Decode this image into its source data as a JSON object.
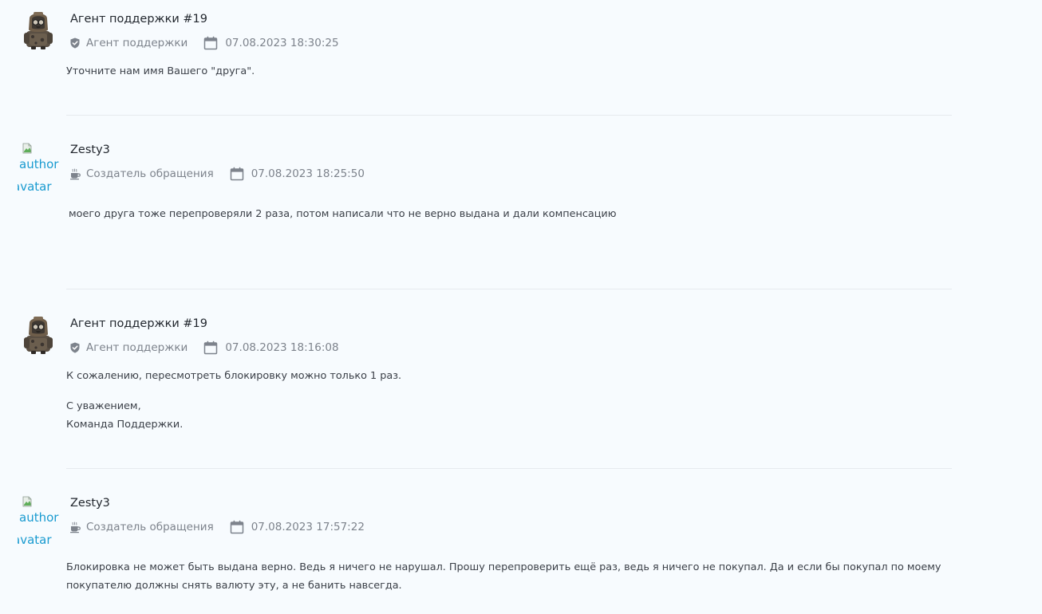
{
  "messages": [
    {
      "author": "Агент поддержки #19",
      "role": "Агент поддержки",
      "datetime": "07.08.2023 18:30:25",
      "lines": [
        "Уточните нам имя Вашего \"друга\"."
      ]
    },
    {
      "author": "Zesty3",
      "role": "Создатель обращения",
      "datetime": "07.08.2023 18:25:50",
      "avatar_alt": [
        "author",
        "avatar"
      ],
      "lines": [
        "моего друга тоже перепроверяли 2 раза, потом написали что не верно выдана и дали компенсацию"
      ]
    },
    {
      "author": "Агент поддержки #19",
      "role": "Агент поддержки",
      "datetime": "07.08.2023 18:16:08",
      "lines": [
        "К сожалению, пересмотреть блокировку можно только 1 раз.",
        "С уважением,",
        "Команда Поддержки."
      ]
    },
    {
      "author": "Zesty3",
      "role": "Создатель обращения",
      "datetime": "07.08.2023 17:57:22",
      "avatar_alt": [
        "author",
        "avatar"
      ],
      "lines": [
        "Блокировка не может быть выдана верно. Ведь я ничего не нарушал. Прошу перепроверить ещё раз, ведь я ничего не покупал. Да и если бы покупал по моему покупателю должны снять валюту эту, а не банить навсегда."
      ]
    }
  ],
  "icons": {
    "agent_role": "shield-icon",
    "creator_role": "coffee-cup-icon",
    "date": "calendar-icon"
  },
  "colors": {
    "background": "#f7fbfe",
    "meta_text": "#7d838c",
    "link": "#1a9bd0"
  }
}
